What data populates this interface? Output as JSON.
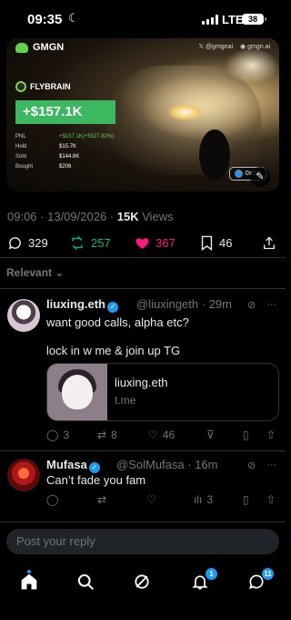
{
  "status_bar": {
    "time": "09:35",
    "network": "LTE",
    "battery": "38"
  },
  "media": {
    "brand": "GMGN",
    "socials": [
      "@gmgnai",
      "gmgn.ai"
    ],
    "token": "FLYBRAIN",
    "pnl_headline": "+$157.1K",
    "stats": [
      {
        "label": "PNL",
        "value": "+$157.1K(+5027.82%)"
      },
      {
        "label": "Hold",
        "value": "$15.7K"
      },
      {
        "label": "Sold",
        "value": "$144.6K"
      },
      {
        "label": "Bought",
        "value": "$206"
      }
    ],
    "handle_badge": "0xf1b"
  },
  "tweet_meta": {
    "time": "09:06",
    "date": "13/09/2026",
    "views_count": "15K",
    "views_label": "Views"
  },
  "tweet_actions": {
    "replies": "329",
    "reposts": "257",
    "likes": "367",
    "bookmarks": "46"
  },
  "sort_label": "Relevant",
  "replies": [
    {
      "name": "liuxing.eth",
      "handle": "@liuxingeth",
      "age": "29m",
      "line1": "want good calls, alpha etc?",
      "line2": "lock in w me & join up TG",
      "card_title": "liuxing.eth",
      "card_domain": "t.me",
      "comments": "3",
      "reposts": "8",
      "likes": "46"
    },
    {
      "name": "Mufasa",
      "handle": "@SolMufasa",
      "age": "16m",
      "text": "Can’t fade you fam",
      "views": "3"
    }
  ],
  "reply_placeholder": "Post your reply",
  "nav": {
    "notifications_badge": "1",
    "messages_badge": "11"
  },
  "colors": {
    "accent": "#1d9bf0",
    "repost": "#00ba7c",
    "like": "#f91880",
    "pnl_box": "#3bb860"
  }
}
